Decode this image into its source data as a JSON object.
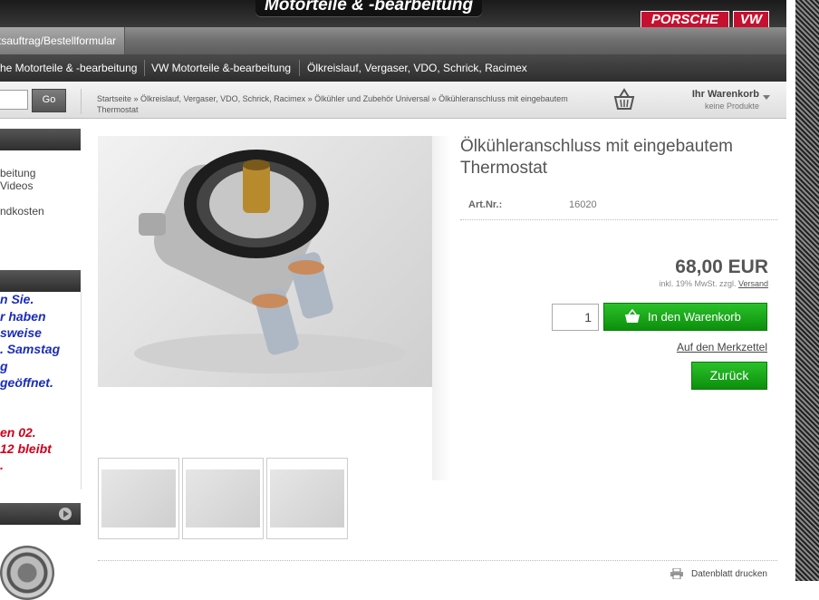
{
  "header": {
    "title": "Motorteile & -bearbeitung",
    "brands": [
      "PORSCHE",
      "VW"
    ]
  },
  "menu1": {
    "item": "tsauftrag/Bestellformular"
  },
  "menu2": {
    "items": [
      "he Motorteile & -bearbeitung",
      "VW Motorteile &-bearbeitung",
      "Ölkreislauf, Vergaser, VDO, Schrick, Racimex"
    ]
  },
  "search": {
    "button": "Go",
    "value": ""
  },
  "breadcrumb": "Startseite » Ölkreislauf, Vergaser, VDO, Schrick, Racimex » Ölkühler und Zubehör Universal » Ölkühleranschluss mit eingebautem Thermostat",
  "cart": {
    "title": "Ihr Warenkorb",
    "subtitle": "keine Produkte"
  },
  "sidebar": {
    "info_lines": [
      "beitung",
      "Videos",
      "ndkosten"
    ],
    "notice_lines_blue": [
      "n Sie.",
      "r haben",
      "sweise",
      ". Samstag",
      "g",
      "geöffnet."
    ],
    "notice_lines_red": [
      "en 02.",
      "12 bleibt",
      "."
    ]
  },
  "product": {
    "title": "Ölkühleranschluss mit eingebautem Thermostat",
    "artnr_label": "Art.Nr.:",
    "artnr_value": "16020",
    "price": "68,00 EUR",
    "tax_note": "inkl. 19% MwSt. zzgl.",
    "shipping_link": "Versand",
    "quantity": "1",
    "add_to_cart": "In den Warenkorb",
    "wishlist": "Auf den Merkzettel",
    "back": "Zurück",
    "datasheet": "Datenblatt drucken"
  },
  "colors": {
    "accent_green": "#1aa81a",
    "brand_red": "#c6102f"
  },
  "icons": [
    "cart-icon",
    "play-icon",
    "printer-icon",
    "shopping-basket-icon"
  ]
}
